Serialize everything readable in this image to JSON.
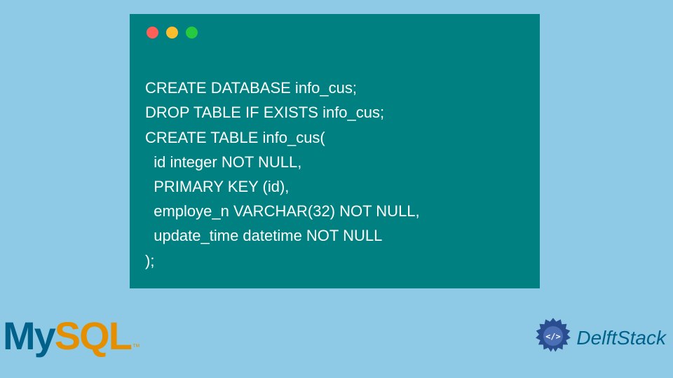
{
  "code": {
    "lines": [
      "CREATE DATABASE info_cus;",
      "DROP TABLE IF EXISTS info_cus;",
      "CREATE TABLE info_cus(",
      "  id integer NOT NULL,",
      "  PRIMARY KEY (id),",
      "  employe_n VARCHAR(32) NOT NULL,",
      "  update_time datetime NOT NULL",
      ");"
    ]
  },
  "logos": {
    "mysql_my": "My",
    "mysql_sql": "SQL",
    "mysql_tm": "™",
    "delftstack": "DelftStack"
  },
  "colors": {
    "background": "#8ecae6",
    "code_bg": "#008080",
    "code_text": "#ffffff",
    "mysql_blue": "#00618a",
    "mysql_orange": "#e48e00",
    "delft_blue": "#3b5998"
  },
  "window_dots": [
    "red",
    "yellow",
    "green"
  ]
}
